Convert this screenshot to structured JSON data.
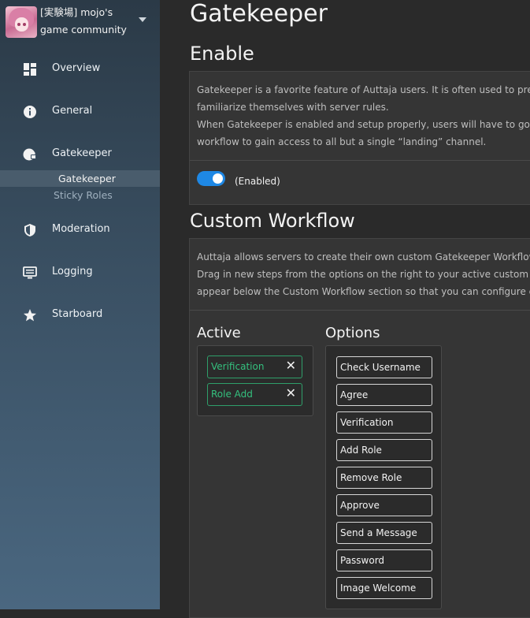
{
  "server": {
    "name": "[実験場] mojo's game community"
  },
  "sidebar": {
    "items": [
      {
        "label": "Overview",
        "icon": "dashboard-icon"
      },
      {
        "label": "General",
        "icon": "info-icon"
      },
      {
        "label": "Gatekeeper",
        "icon": "shield-lock-icon"
      },
      {
        "label": "Moderation",
        "icon": "shield-icon"
      },
      {
        "label": "Logging",
        "icon": "monitor-icon"
      },
      {
        "label": "Starboard",
        "icon": "star-icon"
      }
    ],
    "subitems": [
      {
        "label": "Gatekeeper",
        "active": true
      },
      {
        "label": "Sticky Roles",
        "active": false
      }
    ]
  },
  "main": {
    "title": "Gatekeeper",
    "enable": {
      "heading": "Enable",
      "lines": [
        "Gatekeeper is a favorite feature of Auttaja users. It is often used to preven",
        "familiarize themselves with server rules.",
        "When Gatekeeper is enabled and setup properly, users will have to go thro",
        "workflow to gain access to all but a single “landing” channel."
      ],
      "toggle_label": "(Enabled)",
      "enabled": true
    },
    "workflow": {
      "heading": "Custom Workflow",
      "lines": [
        "Auttaja allows servers to create their own custom Gatekeeper Workflows f",
        "Drag in new steps from the options on the right to your active custom wor",
        "appear below the Custom Workflow section so that you can configure each"
      ],
      "active_title": "Active",
      "active": [
        "Verification",
        "Role Add"
      ],
      "options_title": "Options",
      "options": [
        "Check Username",
        "Agree",
        "Verification",
        "Add Role",
        "Remove Role",
        "Approve",
        "Send a Message",
        "Password",
        "Image Welcome"
      ]
    }
  },
  "colors": {
    "accent": "#1e88e5",
    "active_green": "#34c07e"
  }
}
